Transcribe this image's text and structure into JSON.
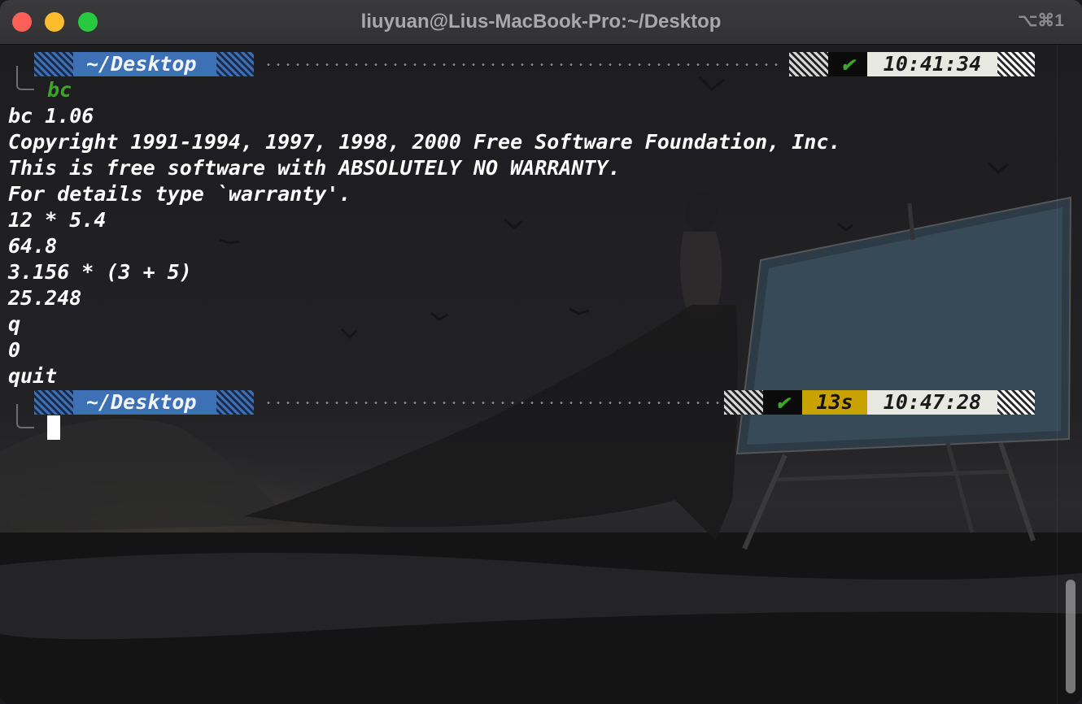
{
  "window": {
    "title": "liuyuan@Lius-MacBook-Pro:~/Desktop",
    "shortcut": "⌥⌘1"
  },
  "prompts": [
    {
      "dir": "~/Desktop",
      "status_icon": "✔",
      "duration": "",
      "time": "10:41:34"
    },
    {
      "dir": "~/Desktop",
      "status_icon": "✔",
      "duration": "13s",
      "time": "10:47:28"
    }
  ],
  "command": "bc",
  "output": [
    "bc 1.06",
    "Copyright 1991-1994, 1997, 1998, 2000 Free Software Foundation, Inc.",
    "This is free software with ABSOLUTELY NO WARRANTY.",
    "For details type `warranty'.",
    "12 * 5.4",
    "64.8",
    "3.156 * (3 + 5)",
    "25.248",
    "q",
    "0",
    "quit"
  ],
  "colors": {
    "prompt_dir_bg": "#3d70b5",
    "status_ok": "#3ea52b",
    "duration_bg": "#c9a200",
    "time_bg": "#e8e8e3"
  }
}
